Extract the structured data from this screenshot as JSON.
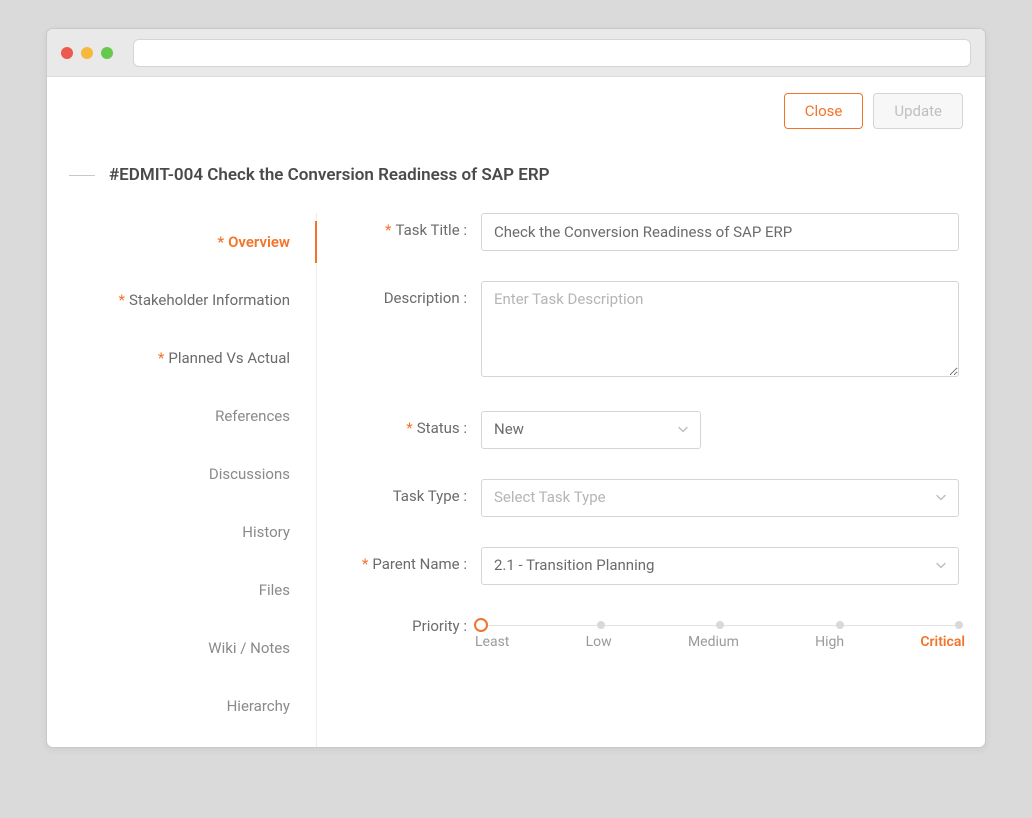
{
  "colors": {
    "accent": "#f2742a"
  },
  "actions": {
    "close_label": "Close",
    "update_label": "Update"
  },
  "page": {
    "title": "#EDMIT-004 Check the Conversion Readiness of SAP ERP"
  },
  "sidebar": {
    "items": [
      {
        "label": "Overview",
        "required": true,
        "active": true
      },
      {
        "label": "Stakeholder Information",
        "required": true,
        "active": false
      },
      {
        "label": "Planned Vs Actual",
        "required": true,
        "active": false
      },
      {
        "label": "References",
        "required": false,
        "active": false
      },
      {
        "label": "Discussions",
        "required": false,
        "active": false
      },
      {
        "label": "History",
        "required": false,
        "active": false
      },
      {
        "label": "Files",
        "required": false,
        "active": false
      },
      {
        "label": "Wiki / Notes",
        "required": false,
        "active": false
      },
      {
        "label": "Hierarchy",
        "required": false,
        "active": false
      }
    ]
  },
  "form": {
    "task_title": {
      "label": "Task Title :",
      "required": true,
      "value": "Check the Conversion Readiness of SAP ERP"
    },
    "description": {
      "label": "Description :",
      "required": false,
      "value": "",
      "placeholder": "Enter Task Description"
    },
    "status": {
      "label": "Status :",
      "required": true,
      "value": "New"
    },
    "task_type": {
      "label": "Task Type :",
      "required": false,
      "value": "",
      "placeholder": "Select Task Type"
    },
    "parent_name": {
      "label": "Parent Name  :",
      "required": true,
      "value": "2.1 - Transition Planning"
    },
    "priority": {
      "label": "Priority :",
      "required": false,
      "options": [
        "Least",
        "Low",
        "Medium",
        "High",
        "Critical"
      ],
      "selected_index": 0,
      "highlighted_index": 4
    }
  }
}
